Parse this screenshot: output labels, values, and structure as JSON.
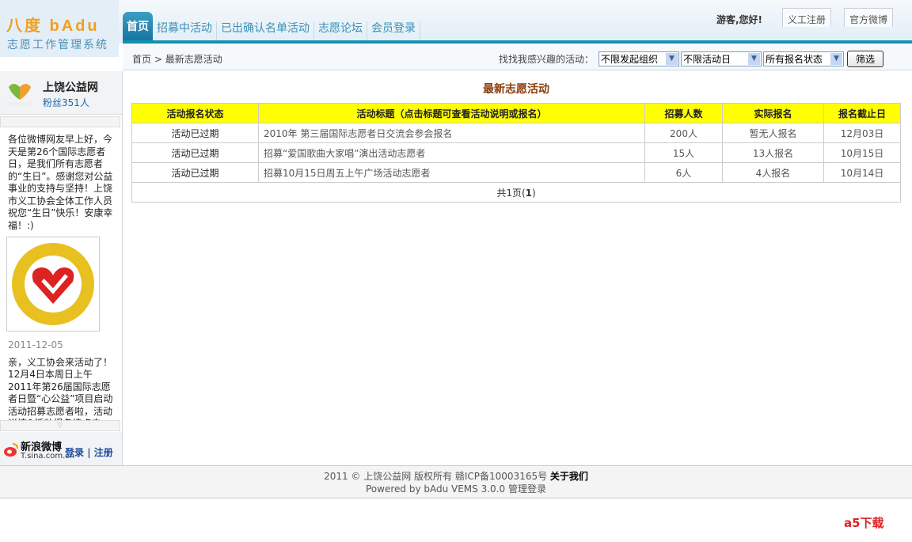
{
  "logo": {
    "line1": "八度 bAdu",
    "line2": "志愿工作管理系统"
  },
  "nav": {
    "tabs": [
      {
        "label": "首页"
      },
      {
        "label": "招募中活动"
      },
      {
        "label": "已出确认名单活动"
      },
      {
        "label": "志愿论坛"
      },
      {
        "label": "会员登录"
      }
    ]
  },
  "topbar": {
    "greeting": "游客,您好!",
    "register": "义工注册",
    "weibo": "官方微博"
  },
  "breadcrumb": {
    "home": "首页",
    "sep": ">",
    "current": "最新志愿活动"
  },
  "filter": {
    "label": "找找我感兴趣的活动：",
    "org": "不限发起组织",
    "day": "不限活动日",
    "status": "所有报名状态",
    "button": "筛选"
  },
  "sidebar": {
    "name": "上饶公益网",
    "fans": "粉丝351人",
    "post1": "各位微博网友早上好，今天是第26个国际志愿者日，是我们所有志愿者的“生日”。感谢您对公益事业的支持与坚持！上饶市义工协会全体工作人员祝您“生日”快乐！安康幸福！:)",
    "date": "2011-12-05",
    "post2": "亲，义工协会来活动了！12月4日本周日上午2011年第26届国际志愿者日暨“心公益”项目启动活动招募志愿者啦，活动详情&活动报名请点击",
    "sina_name": "新浪微博",
    "sina_url": "T.sina.com.cn",
    "login": "登录",
    "register": "注册"
  },
  "main": {
    "title": "最新志愿活动",
    "headers": [
      "活动报名状态",
      "活动标题（点击标题可查看活动说明或报名）",
      "招募人数",
      "实际报名",
      "报名截止日"
    ],
    "rows": [
      {
        "status": "活动已过期",
        "title": "2010年 第三届国际志愿者日交流会参会报名",
        "quota": "200人",
        "signed": "暂无人报名",
        "deadline": "12月03日"
      },
      {
        "status": "活动已过期",
        "title": "招募“爱国歌曲大家唱”演出活动志愿者",
        "quota": "15人",
        "signed": "13人报名",
        "deadline": "10月15日"
      },
      {
        "status": "活动已过期",
        "title": "招募10月15日周五上午广场活动志愿者",
        "quota": "6人",
        "signed": "4人报名",
        "deadline": "10月14日"
      }
    ],
    "pager_prefix": "共1页(",
    "pager_page": "1",
    "pager_suffix": ")"
  },
  "footer": {
    "line1": "2011 © 上饶公益网 版权所有 赣ICP备10003165号",
    "about": "关于我们",
    "line2": "Powered by bAdu VEMS 3.0.0",
    "admin": "管理登录"
  },
  "watermark": "a5下载"
}
